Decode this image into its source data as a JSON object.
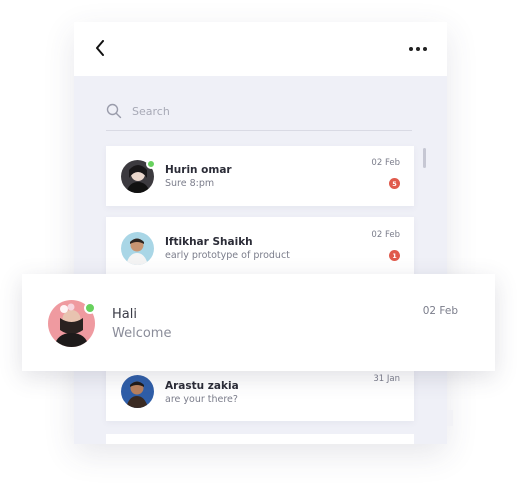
{
  "header": {
    "back_icon": "chevron-left-icon",
    "more_icon": "more-horizontal-icon"
  },
  "search": {
    "placeholder": "Search",
    "icon": "search-icon"
  },
  "conversations": [
    {
      "name": "Hurin omar",
      "message": "Sure 8:pm",
      "date": "02 Feb",
      "unread": "5",
      "online": true
    },
    {
      "name": "Iftikhar Shaikh",
      "message": "early prototype of product",
      "date": "02 Feb",
      "unread": "1",
      "online": false
    },
    {
      "name": "Arastu zakia",
      "message": "are your there?",
      "date": "31 Jan",
      "online": false
    }
  ],
  "highlighted": {
    "name": "Hali",
    "message": "Welcome",
    "date": "02 Feb",
    "online": true
  },
  "colors": {
    "background": "#eff0f7",
    "online": "#68d15e",
    "badge": "#e05a4c"
  }
}
